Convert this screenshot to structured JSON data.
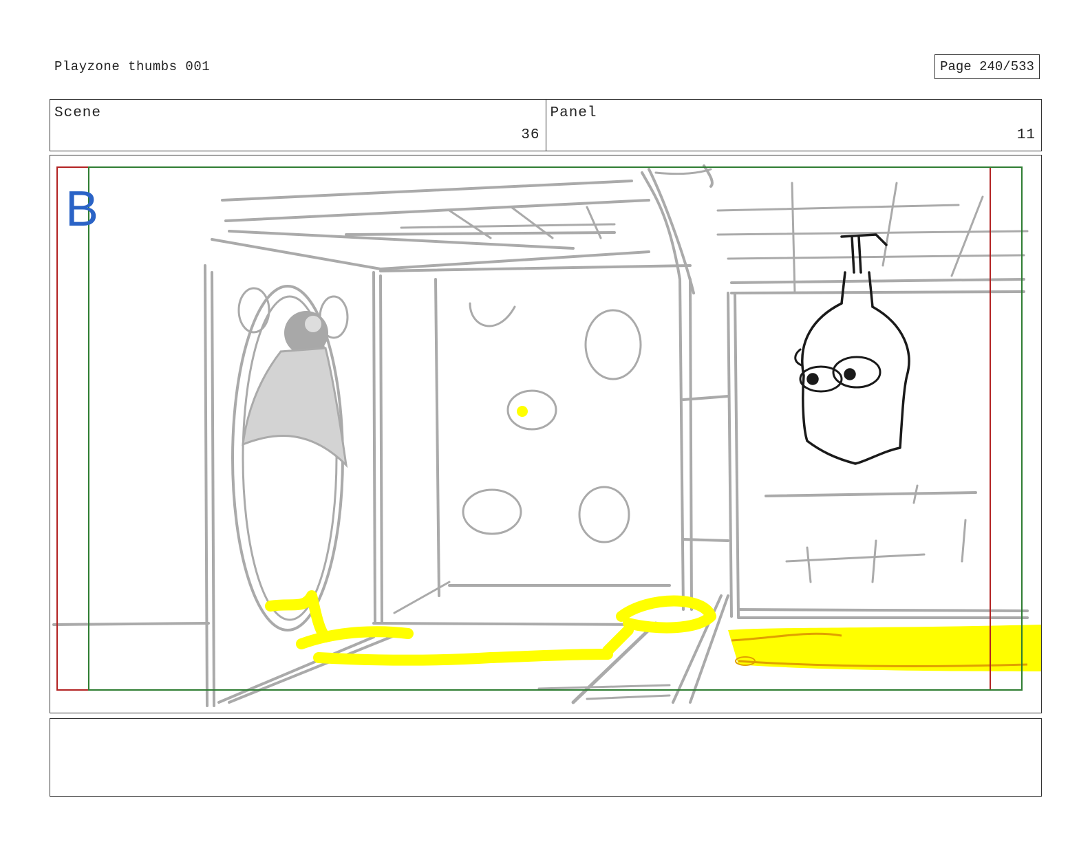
{
  "header": {
    "title": "Playzone thumbs 001",
    "page_label": "Page 240/533"
  },
  "info": {
    "scene_label": "Scene",
    "scene_value": "36",
    "panel_label": "Panel",
    "panel_value": "11"
  },
  "panel": {
    "letter": "B",
    "safe_frame_color": "#b22222",
    "action_frame_color": "#2e7d32",
    "sketch_color": "#aaaaaa",
    "highlight_color": "#ffff00",
    "character_color": "#1a1a1a"
  },
  "notes": {
    "text": ""
  }
}
